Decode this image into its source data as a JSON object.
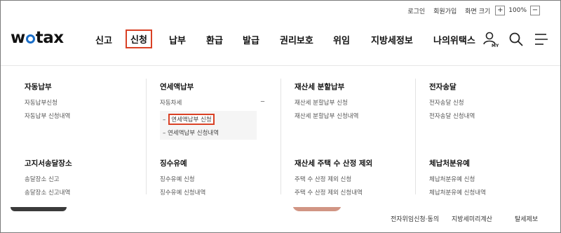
{
  "util": {
    "login": "로그인",
    "signup": "회원가입",
    "zoom_label": "화면 크기",
    "zoom_in": "+",
    "zoom_value": "100%",
    "zoom_out": "−"
  },
  "logo": {
    "pre": "w",
    "post": "tax"
  },
  "nav": [
    "신고",
    "신청",
    "납부",
    "환급",
    "발급",
    "권리보호",
    "위임",
    "지방세정보",
    "나의위택스"
  ],
  "header_icons": {
    "my_label": "MY"
  },
  "mega": {
    "col1": {
      "group1": {
        "title": "자동납부",
        "items": [
          "자동납부신청",
          "자동납부 신청내역"
        ]
      },
      "group2": {
        "title": "고지서송달장소",
        "items": [
          "송달장소 신고",
          "송달장소 신고내역"
        ]
      }
    },
    "col2": {
      "group1": {
        "title": "연세액납부",
        "expandable": "자동차세",
        "collapse_sign": "−",
        "subitems": [
          "연세액납부 신청",
          "연세액납부 신청내역"
        ],
        "sub_prefix": "–"
      },
      "group2": {
        "title": "징수유예",
        "items": [
          "징수유예 신청",
          "징수유예 신청내역"
        ]
      }
    },
    "col3": {
      "group1": {
        "title": "재산세 분할납부",
        "items": [
          "재산세 분할납부 신청",
          "재산세 분할납부 신청내역"
        ]
      },
      "group2": {
        "title": "재산세 주택 수 산정 제외",
        "items": [
          "주택 수 산정 제외 신청",
          "주택 수 산정 제외 신청내역"
        ]
      }
    },
    "col4": {
      "group1": {
        "title": "전자송달",
        "items": [
          "전자송달 신청",
          "전자송달 신청내역"
        ]
      },
      "group2": {
        "title": "체납처분유예",
        "items": [
          "체납처분유예 신청",
          "체납처분유예 신청내역"
        ]
      }
    }
  },
  "quick_links": [
    "전자위임신청·동의",
    "지방세미리계산",
    "탈세제보"
  ],
  "colors": {
    "highlight": "#d94125",
    "logo_accent": "#1a6ec8"
  }
}
